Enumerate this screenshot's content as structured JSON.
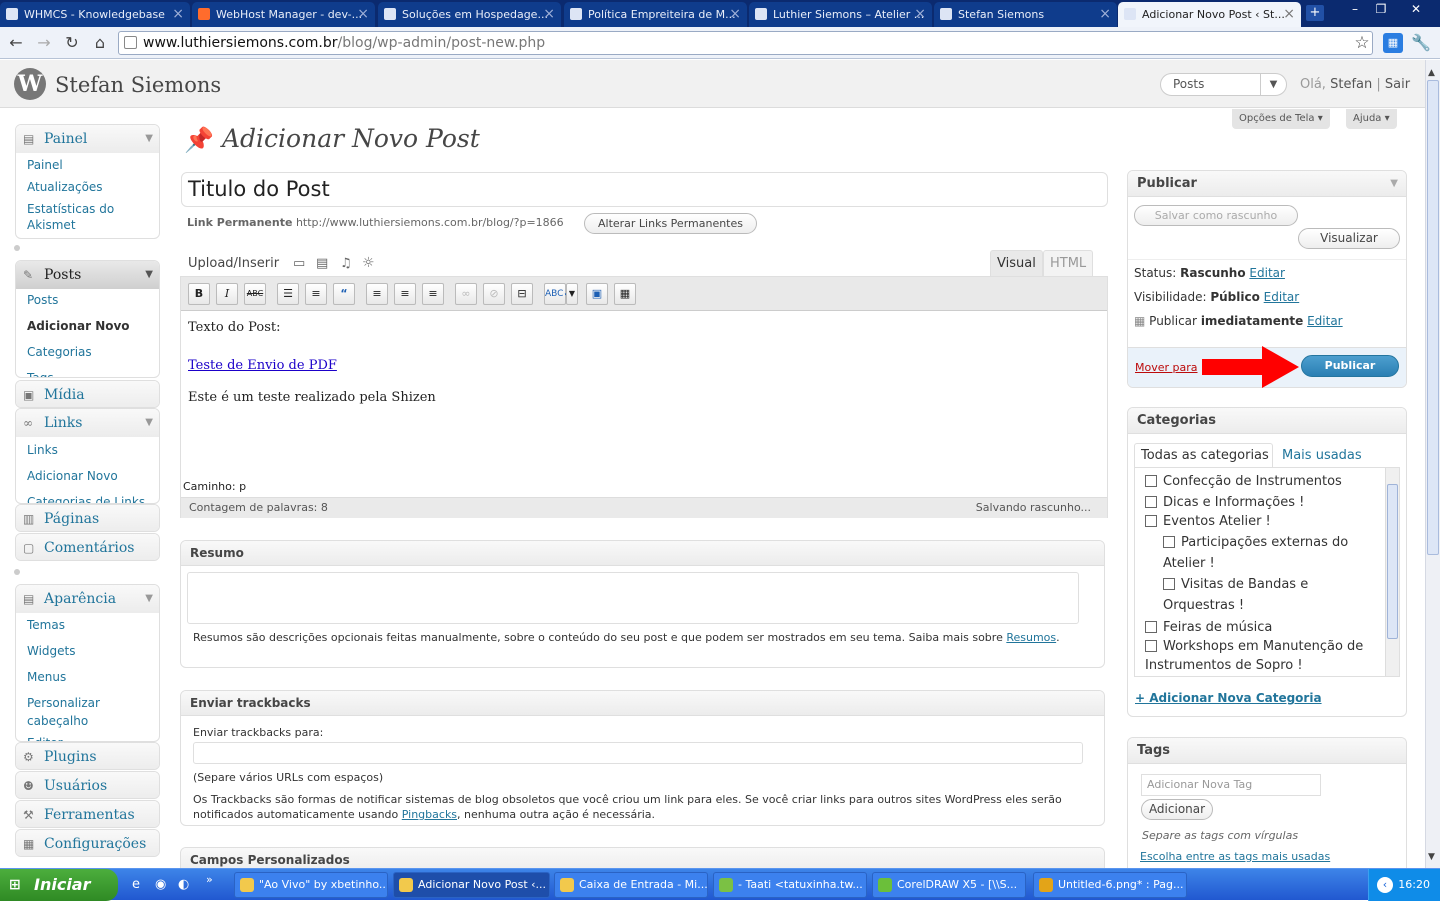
{
  "browser": {
    "tabs": [
      {
        "title": "WHMCS - Knowledgebase"
      },
      {
        "title": "WebHost Manager - dev-..."
      },
      {
        "title": "Soluções em Hospedage..."
      },
      {
        "title": "Política Empreiteira de M..."
      },
      {
        "title": "Luthier Siemons – Atelier ..."
      },
      {
        "title": "Stefan Siemons"
      },
      {
        "title": "Adicionar Novo Post ‹ St..."
      }
    ],
    "url_host": "www.luthiersiemons.com.br",
    "url_path": "/blog/wp-admin/post-new.php"
  },
  "wp_header": {
    "site_name": "Stefan Siemons",
    "favorites_value": "Posts",
    "greeting": "Olá,",
    "user_name": "Stefan",
    "separator": "|",
    "logout": "Sair"
  },
  "screen_options": "Opções de Tela",
  "help": "Ajuda",
  "sidebar": {
    "painel": {
      "title": "Painel",
      "items": [
        "Painel",
        "Atualizações",
        "Estatísticas do",
        "Akismet"
      ]
    },
    "posts": {
      "title": "Posts",
      "items": [
        "Posts",
        "Adicionar Novo",
        "Categorias",
        "Tags"
      ]
    },
    "midia": "Mídia",
    "links": {
      "title": "Links",
      "items": [
        "Links",
        "Adicionar Novo",
        "Categorias de Links"
      ]
    },
    "paginas": "Páginas",
    "comentarios": "Comentários",
    "aparencia": {
      "title": "Aparência",
      "items": [
        "Temas",
        "Widgets",
        "Menus",
        "Personalizar",
        "cabeçalho",
        "Editor"
      ]
    },
    "plugins": "Plugins",
    "usuarios": "Usuários",
    "ferramentas": "Ferramentas",
    "configuracoes": "Configurações"
  },
  "main": {
    "page_title": "Adicionar Novo Post",
    "post_title": "Titulo do Post",
    "permalink_label": "Link Permanente",
    "permalink_url": "http://www.luthiersiemons.com.br/blog/?p=1866",
    "permalink_button": "Alterar Links Permanentes",
    "upload_insert": "Upload/Inserir",
    "tab_visual": "Visual",
    "tab_html": "HTML",
    "toolbar": {
      "bold": "B",
      "italic": "I",
      "strike": "ABC"
    },
    "content": {
      "line1": "Texto do Post:",
      "link": "Teste de Envio de PDF",
      "line3": "Este é um teste realizado pela Shizen"
    },
    "path_label": "Caminho: p",
    "word_count": "Contagem de palavras: 8",
    "autosave": "Salvando rascunho..."
  },
  "excerpt": {
    "title": "Resumo",
    "help": "Resumos são descrições opcionais feitas manualmente, sobre o conteúdo do seu post e que podem ser mostrados em seu tema. Saiba mais sobre",
    "link": "Resumos",
    "period": "."
  },
  "trackbacks": {
    "title": "Enviar trackbacks",
    "label": "Enviar trackbacks para:",
    "hint": "(Separe vários URLs com espaços)",
    "desc1": "Os Trackbacks são formas de notificar sistemas de blog obsoletos que você criou um link para eles. Se você criar links para outros sites WordPress eles serão notificados automaticamente usando",
    "link": "Pingbacks",
    "desc2": ", nenhuma outra ação é necessária."
  },
  "custom_fields": {
    "title": "Campos Personalizados"
  },
  "publish": {
    "title": "Publicar",
    "save_draft": "Salvar como rascunho",
    "preview": "Visualizar",
    "status_label": "Status:",
    "status_value": "Rascunho",
    "visibility_label": "Visibilidade:",
    "visibility_value": "Público",
    "publish_label": "Publicar",
    "publish_value": "imediatamente",
    "edit": "Editar",
    "trash": "Mover para",
    "publish_button": "Publicar"
  },
  "categories": {
    "title": "Categorias",
    "tab_all": "Todas as categorias",
    "tab_popular": "Mais usadas",
    "items": [
      "Confecção de Instrumentos",
      "Dicas e Informações !",
      "Eventos Atelier !",
      "Participações externas do",
      "Atelier !",
      "Visitas de Bandas e",
      "Orquestras !",
      "Feiras de música",
      "Workshops em Manutenção de",
      "Instrumentos de Sopro !"
    ],
    "add_new": "+ Adicionar Nova Categoria"
  },
  "tags": {
    "title": "Tags",
    "placeholder": "Adicionar Nova Tag",
    "add_button": "Adicionar",
    "hint": "Separe as tags com vírgulas",
    "choose": "Escolha entre as tags mais usadas"
  },
  "taskbar": {
    "start": "Iniciar",
    "tasks": [
      "\"Ao Vivo\" by xbetinho...",
      "Adicionar Novo Post ‹...",
      "Caixa de Entrada - Mi...",
      "- Taati <tatuxinha.tw...",
      "CorelDRAW X5 - [\\\\S...",
      "Untitled-6.png* : Pag..."
    ],
    "clock": "16:20"
  }
}
